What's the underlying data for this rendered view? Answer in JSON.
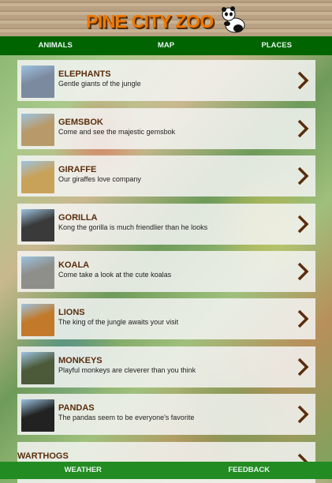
{
  "header": {
    "logo_text": "PINE CITY ZOO"
  },
  "nav": [
    {
      "label": "ANIMALS"
    },
    {
      "label": "MAP"
    },
    {
      "label": "PLACES"
    }
  ],
  "animals": [
    {
      "title": "ELEPHANTS",
      "desc": "Gentle giants of the jungle",
      "thumb_color": "#7c8aa0"
    },
    {
      "title": "GEMSBOK",
      "desc": "Come and see the majestic gemsbok",
      "thumb_color": "#b89a6a"
    },
    {
      "title": "GIRAFFE",
      "desc": "Our giraffes love company",
      "thumb_color": "#c9a25a"
    },
    {
      "title": "GORILLA",
      "desc": "Kong the gorilla is much friendlier than he looks",
      "thumb_color": "#3a3a3a"
    },
    {
      "title": "KOALA",
      "desc": "Come take a look at the cute koalas",
      "thumb_color": "#8e8e8a"
    },
    {
      "title": "LIONS",
      "desc": "The king of the jungle awaits your visit",
      "thumb_color": "#c27a2a"
    },
    {
      "title": "MONKEYS",
      "desc": "Playful monkeys are cleverer than you think",
      "thumb_color": "#4c5a3a"
    },
    {
      "title": "PANDAS",
      "desc": "The pandas seem to be everyone's favorite",
      "thumb_color": "#222222"
    },
    {
      "title": "WARTHOGS",
      "desc": "",
      "thumb_color": ""
    }
  ],
  "footer": [
    {
      "label": "WEATHER"
    },
    {
      "label": "FEEDBACK"
    }
  ],
  "colors": {
    "nav": "#006400",
    "footer": "#228b22",
    "title": "#5a2d0c",
    "logo": "#f07800"
  }
}
